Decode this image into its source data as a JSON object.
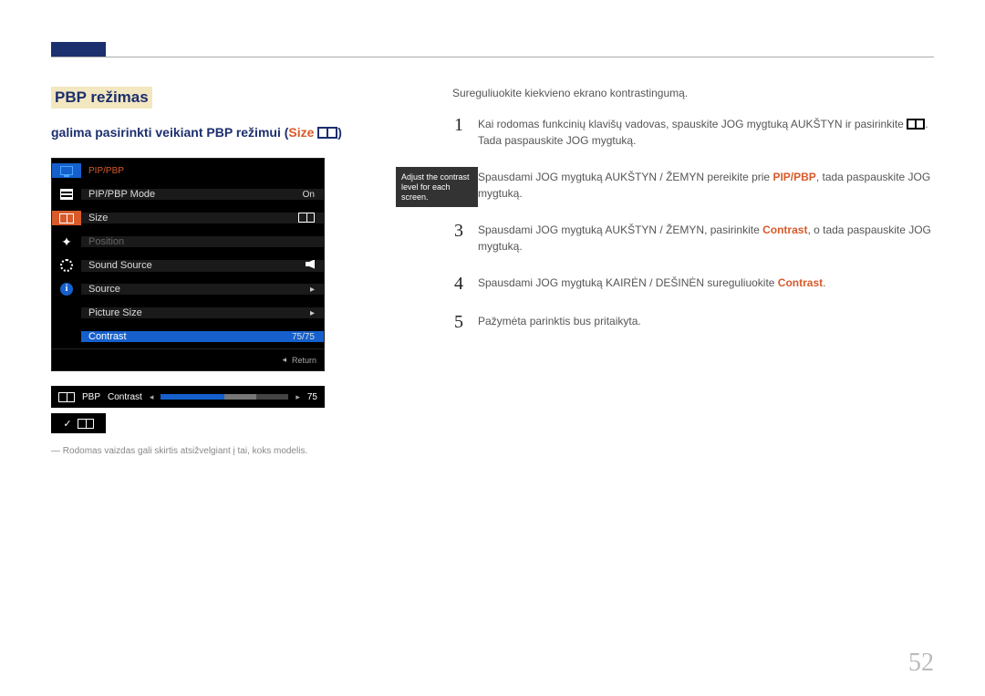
{
  "page_number": "52",
  "heading": "PBP režimas",
  "subheading_prefix": "galima pasirinkti veikiant PBP režimui (",
  "subheading_size": "Size",
  "subheading_suffix": ")",
  "osd": {
    "menu_title": "PIP/PBP",
    "tooltip": "Adjust the contrast level for each screen.",
    "rows": {
      "mode_label": "PIP/PBP Mode",
      "mode_value": "On",
      "size_label": "Size",
      "position_label": "Position",
      "sound_label": "Sound Source",
      "source_label": "Source",
      "picsize_label": "Picture Size",
      "contrast_label": "Contrast",
      "contrast_value": "75/75"
    },
    "return": "Return"
  },
  "slider": {
    "prefix": "PBP",
    "label": "Contrast",
    "value": "75"
  },
  "footnote": "Rodomas vaizdas gali skirtis atsižvelgiant į tai, koks modelis.",
  "intro": "Sureguliuokite kiekvieno ekrano kontrastingumą.",
  "steps": {
    "s1a": "Kai rodomas funkcinių klavišų vadovas, spauskite JOG mygtuką AUKŠTYN ir pasirinkite ",
    "s1b": ". Tada paspauskite JOG mygtuką.",
    "s2a": "Spausdami JOG mygtuką AUKŠTYN / ŽEMYN pereikite prie ",
    "s2hl": "PIP/PBP",
    "s2b": ", tada paspauskite JOG mygtuką.",
    "s3a": "Spausdami JOG mygtuką AUKŠTYN / ŽEMYN, pasirinkite ",
    "s3hl": "Contrast",
    "s3b": ", o tada paspauskite JOG mygtuką.",
    "s4a": "Spausdami JOG mygtuką KAIRĖN / DEŠINĖN sureguliuokite ",
    "s4hl": "Contrast",
    "s4b": ".",
    "s5": "Pažymėta parinktis bus pritaikyta."
  }
}
